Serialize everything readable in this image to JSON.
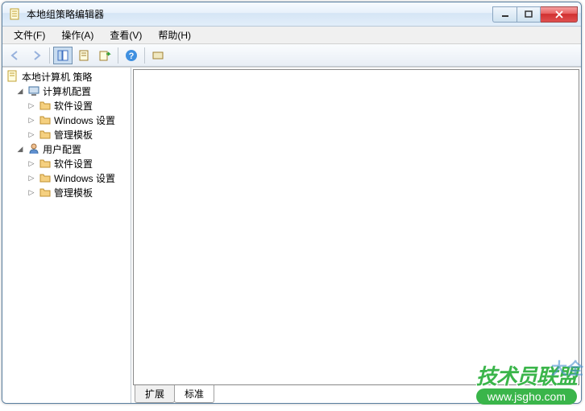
{
  "window": {
    "title": "本地组策略编辑器"
  },
  "menu": {
    "file": "文件(F)",
    "action": "操作(A)",
    "view": "查看(V)",
    "help": "帮助(H)"
  },
  "tree": {
    "root": "本地计算机 策略",
    "computer_config": "计算机配置",
    "comp_software": "软件设置",
    "comp_windows": "Windows 设置",
    "comp_admin": "管理模板",
    "user_config": "用户配置",
    "user_software": "软件设置",
    "user_windows": "Windows 设置",
    "user_admin": "管理模板"
  },
  "tabs": {
    "extended": "扩展",
    "standard": "标准"
  },
  "watermark": {
    "text": "技术员联盟",
    "url": "www.jsgho.com",
    "side": "大全"
  }
}
